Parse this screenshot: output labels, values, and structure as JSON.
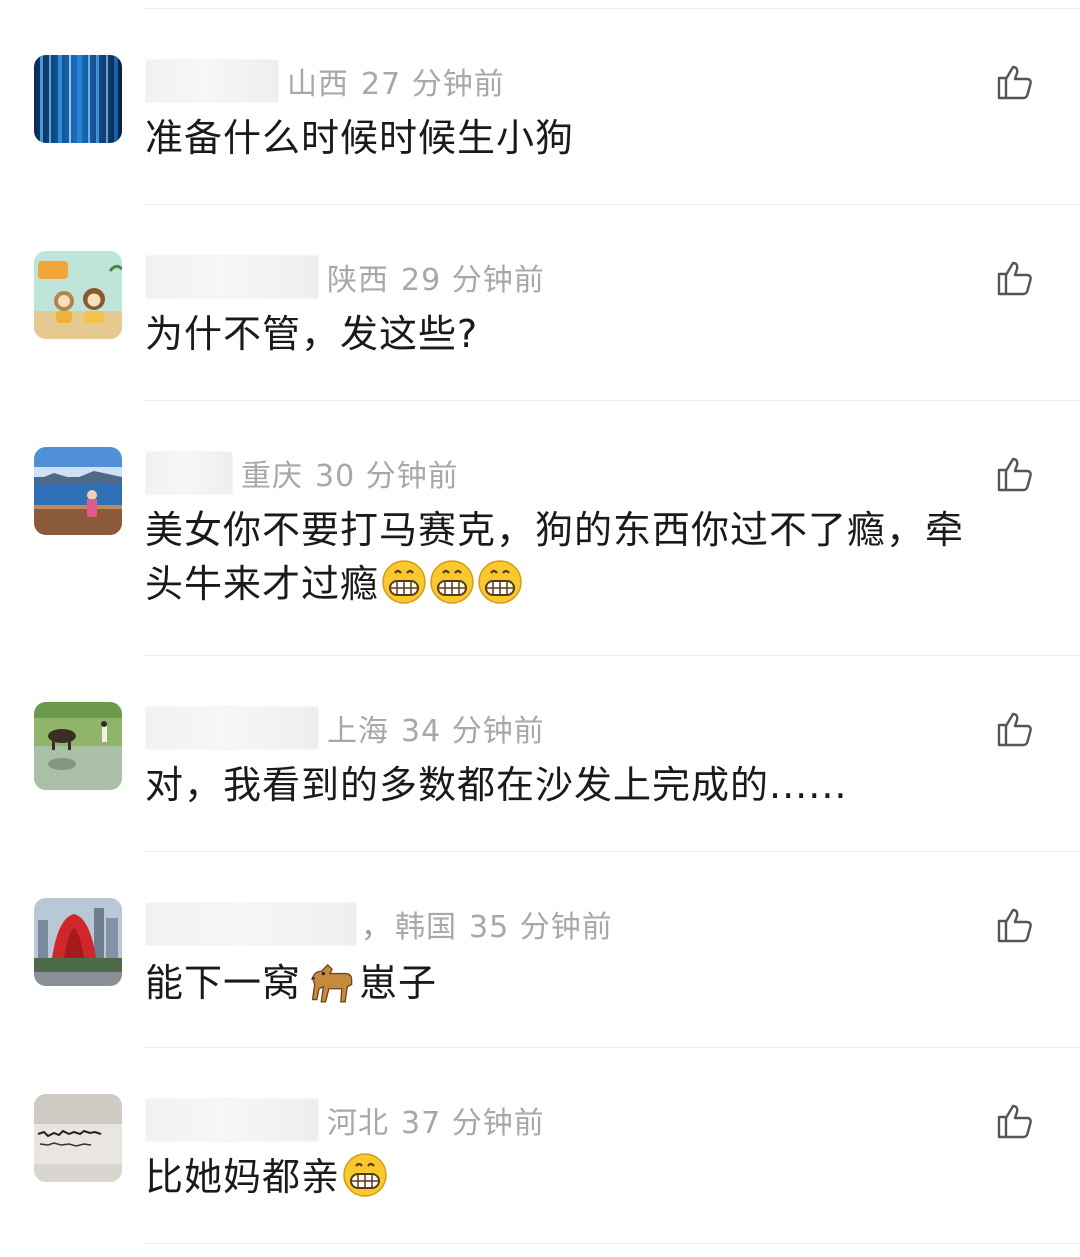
{
  "comments": [
    {
      "region": "山西",
      "time": "27 分钟前",
      "text": "准备什么时候时候生小狗",
      "avatar": "blue-light-streaks",
      "emojis": []
    },
    {
      "region": "陕西",
      "time": "29 分钟前",
      "text": "为什不管，发这些?",
      "avatar": "cartoon-toys",
      "emojis": []
    },
    {
      "region": "重庆",
      "time": "30 分钟前",
      "text": "美女你不要打马赛克，狗的东西你过不了瘾，牵头牛来才过瘾",
      "avatar": "lake-balcony",
      "emojis": [
        "grin-emoji",
        "grin-emoji",
        "grin-emoji"
      ]
    },
    {
      "region": "上海",
      "time": "34 分钟前",
      "text": "对，我看到的多数都在沙发上完成的......",
      "avatar": "field-with-cow",
      "emojis": []
    },
    {
      "region": "韩国",
      "time": "35 分钟前",
      "text_before": "能下一窝",
      "text_after": "崽子",
      "avatar": "red-sculpture-city",
      "emojis": [
        "dog-emoji"
      ],
      "comma": "，"
    },
    {
      "region": "河北",
      "time": "37 分钟前",
      "text": "比她妈都亲",
      "avatar": "calligraphy-paper",
      "emojis": [
        "grin-emoji"
      ]
    }
  ],
  "colors": {
    "meta": "#a8a8a8",
    "text": "#1a1a1a",
    "divider": "#ececec",
    "icon": "#555555"
  }
}
